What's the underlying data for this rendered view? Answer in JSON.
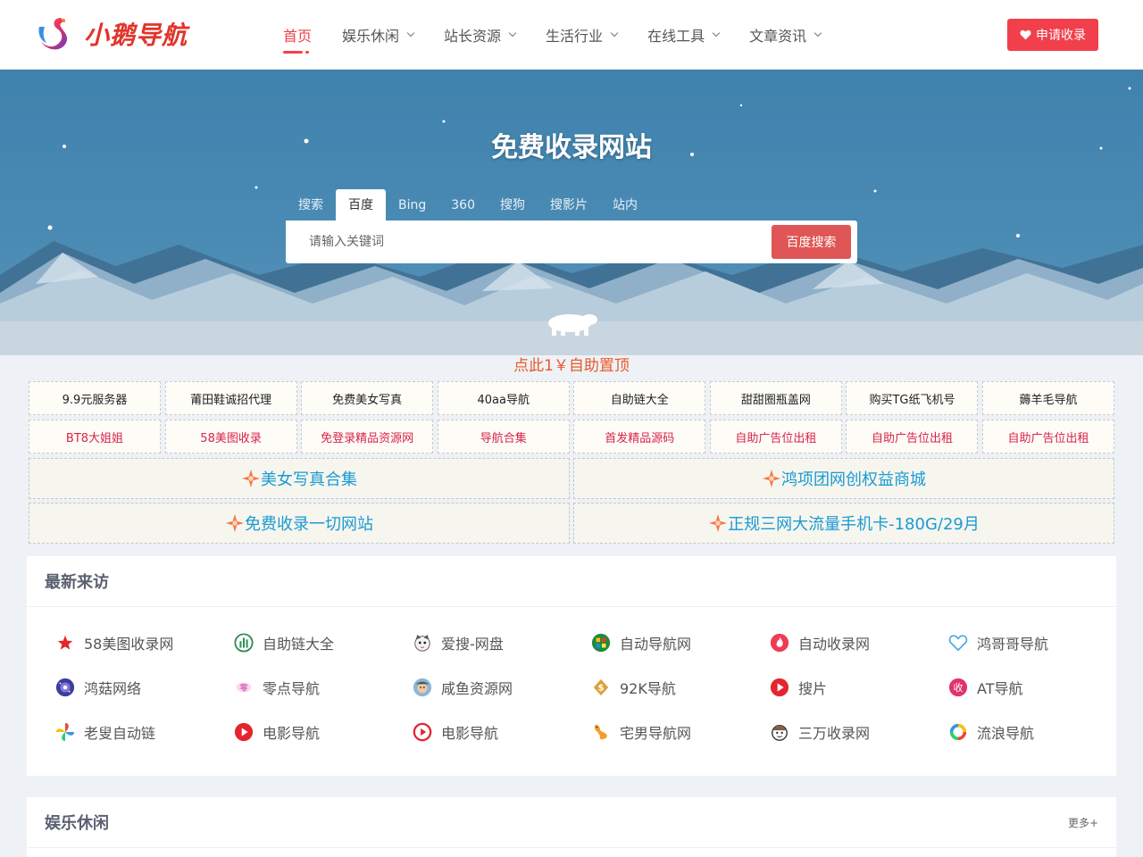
{
  "header": {
    "logo_text": "小鹅导航",
    "nav": [
      {
        "label": "首页",
        "active": true,
        "dropdown": false
      },
      {
        "label": "娱乐休闲",
        "active": false,
        "dropdown": true
      },
      {
        "label": "站长资源",
        "active": false,
        "dropdown": true
      },
      {
        "label": "生活行业",
        "active": false,
        "dropdown": true
      },
      {
        "label": "在线工具",
        "active": false,
        "dropdown": true
      },
      {
        "label": "文章资讯",
        "active": false,
        "dropdown": true
      }
    ],
    "apply_label": "申请收录"
  },
  "hero": {
    "title": "免费收录网站",
    "tabs": [
      "搜索",
      "百度",
      "Bing",
      "360",
      "搜狗",
      "搜影片",
      "站内"
    ],
    "active_tab": 1,
    "search_placeholder": "请输入关键词",
    "search_button": "百度搜索"
  },
  "ads": {
    "title": "点此1￥自助置顶",
    "row1": [
      "9.9元服务器",
      "莆田鞋诚招代理",
      "免费美女写真",
      "40aa导航",
      "自助链大全",
      "甜甜圈瓶盖网",
      "购买TG纸飞机号",
      "薅羊毛导航"
    ],
    "row2": [
      "BT8大姐姐",
      "58美图收录",
      "免登录精品资源网",
      "导航合集",
      "首发精品源码",
      "自助广告位出租",
      "自助广告位出租",
      "自助广告位出租"
    ],
    "big": [
      [
        "美女写真合集",
        "鸿项团网创权益商城"
      ],
      [
        "免费收录一切网站",
        "正规三网大流量手机卡-180G/29月"
      ]
    ]
  },
  "recent": {
    "title": "最新来访",
    "rows": [
      [
        {
          "label": "58美图收录网",
          "icon": "red-star-icon"
        },
        {
          "label": "自助链大全",
          "icon": "green-bars-icon"
        },
        {
          "label": "爱搜-网盘",
          "icon": "cat-icon"
        },
        {
          "label": "自动导航网",
          "icon": "tiles-icon"
        },
        {
          "label": "自动收录网",
          "icon": "flame-icon"
        },
        {
          "label": "鸿哥哥导航",
          "icon": "heart-outline-icon"
        }
      ],
      [
        {
          "label": "鸿菇网络",
          "icon": "galaxy-icon"
        },
        {
          "label": "零点导航",
          "icon": "zero-badge-icon"
        },
        {
          "label": "咸鱼资源网",
          "icon": "fish-icon"
        },
        {
          "label": "92K导航",
          "icon": "gold-diamond-icon"
        },
        {
          "label": "搜片",
          "icon": "red-play-icon"
        },
        {
          "label": "AT导航",
          "icon": "shou-badge-icon"
        }
      ],
      [
        {
          "label": "老叟自动链",
          "icon": "pinwheel-icon"
        },
        {
          "label": "电影导航",
          "icon": "play-circle-icon"
        },
        {
          "label": "电影导航",
          "icon": "play-ring-icon"
        },
        {
          "label": "宅男导航网",
          "icon": "bird-icon"
        },
        {
          "label": "三万收录网",
          "icon": "mascot-icon"
        },
        {
          "label": "流浪导航",
          "icon": "color-ring-icon"
        }
      ]
    ]
  },
  "entertainment": {
    "title": "娱乐休闲",
    "more": "更多+"
  },
  "colors": {
    "accent": "#f1404b",
    "hero_blue": "#4a8bb4",
    "ad_orange": "#e8592a",
    "link_blue": "#1a9ad4"
  }
}
